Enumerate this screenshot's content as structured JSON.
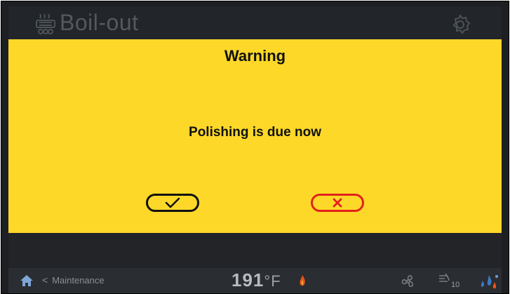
{
  "header": {
    "title": "Boil-out",
    "title_icon": "fryer-basket-icon",
    "settings_icon": "gear-icon"
  },
  "dialog": {
    "title": "Warning",
    "message": "Polishing is due now",
    "confirm_icon": "check-icon",
    "cancel_icon": "close-icon",
    "background_color": "#fdd828",
    "cancel_color": "#e2211c"
  },
  "footer": {
    "home_icon": "home-icon",
    "back_label": "Maintenance",
    "temperature": "191",
    "temperature_unit": "°F",
    "oil_count": "10"
  }
}
